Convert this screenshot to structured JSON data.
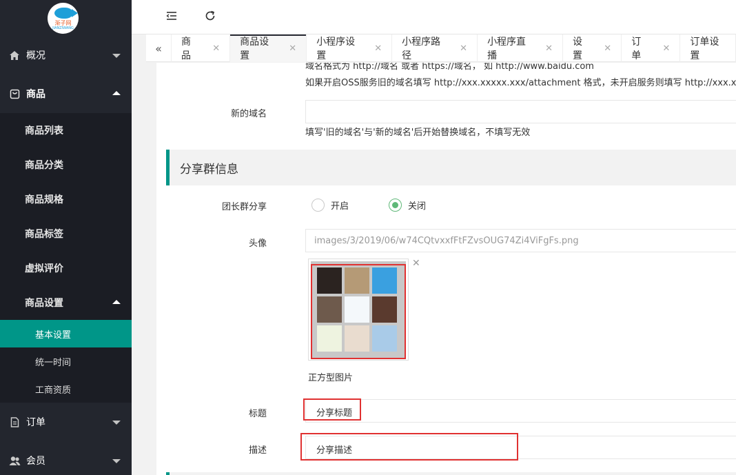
{
  "logo": {
    "name": "渐子网",
    "sub": "JIANZIWANG"
  },
  "sidebar": {
    "overview": "概况",
    "product": "商品",
    "product_items": [
      "商品列表",
      "商品分类",
      "商品规格",
      "商品标签",
      "虚拟评价"
    ],
    "product_settings": "商品设置",
    "settings_items": [
      "基本设置",
      "统一时间",
      "工商资质"
    ],
    "order": "订单",
    "member": "会员"
  },
  "tabs": [
    {
      "label": "商品",
      "active": false
    },
    {
      "label": "商品设置",
      "active": true
    },
    {
      "label": "小程序设置",
      "active": false
    },
    {
      "label": "小程序路径",
      "active": false
    },
    {
      "label": "小程序直播",
      "active": false
    },
    {
      "label": "设置",
      "active": false
    },
    {
      "label": "订单",
      "active": false
    },
    {
      "label": "订单设置",
      "active": false
    }
  ],
  "form": {
    "domain_help_1": "域名格式为 http://域名 或者 https://域名，  如 http://www.baidu.com",
    "domain_help_2": "如果开启OSS服务旧的域名填写 http://xxx.xxxxx.xxx/attachment 格式，未开启服务则填写 http://xxx.xxxx.x",
    "new_domain_label": "新的域名",
    "new_domain_value": "",
    "new_domain_help": "填写'旧的域名'与'新的域名'后开始替换域名，不填写无效",
    "section_title": "分享群信息",
    "leader_share_label": "团长群分享",
    "radio_on": "开启",
    "radio_off": "关闭",
    "radio_selected": "关闭",
    "avatar_label": "头像",
    "avatar_value": "images/3/2019/06/w74CQtvxxfFtFZvsOUG74Zi4ViFgFs.png",
    "avatar_caption": "正方型图片",
    "title_label": "标题",
    "title_value": "分享标题",
    "desc_label": "描述",
    "desc_value": "分享描述"
  },
  "colors": {
    "sidebar_bg": "#23262e",
    "accent": "#009688",
    "radio_on": "#5fb878",
    "highlight": "#e03131"
  }
}
